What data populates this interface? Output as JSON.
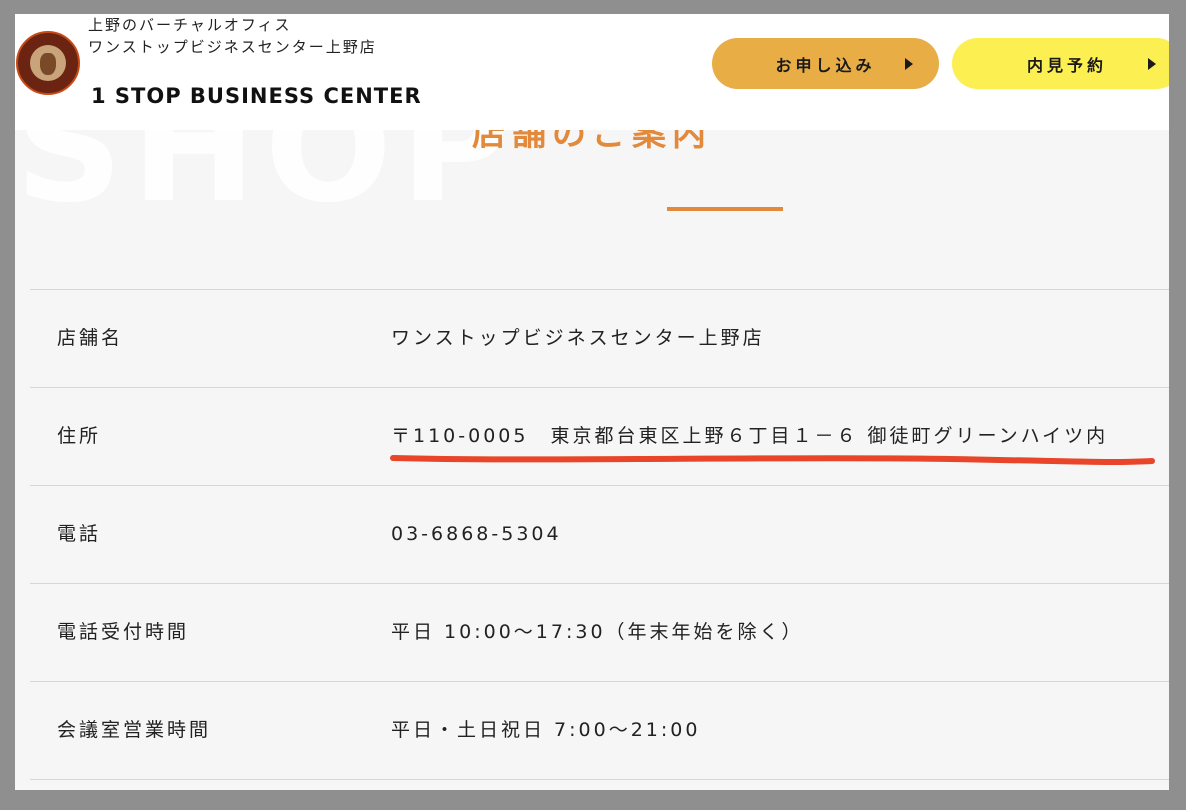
{
  "section": {
    "bg_word": "SHOP",
    "title": "店舗のご案内"
  },
  "header": {
    "tagline_line1": "上野のバーチャルオフィス",
    "tagline_line2": "ワンストップビジネスセンター上野店",
    "brand": "1 STOP BUSINESS CENTER",
    "logo_icon": "business-center-mascot-logo",
    "apply_label": "お申し込み",
    "visit_label": "内見予約"
  },
  "info_table": {
    "rows": [
      {
        "label": "店舗名",
        "value": "ワンストップビジネスセンター上野店"
      },
      {
        "label": "住所",
        "value": "〒110-0005　東京都台東区上野６丁目１－６ 御徒町グリーンハイツ内"
      },
      {
        "label": "電話",
        "value": "03-6868-5304"
      },
      {
        "label": "電話受付時間",
        "value": "平日 10:00〜17:30（年末年始を除く）"
      },
      {
        "label": "会議室営業時間",
        "value": "平日・土日祝日 7:00〜21:00"
      }
    ]
  },
  "colors": {
    "accent_orange": "#e3893b",
    "apply_button": "#e8ad45",
    "visit_button": "#fcef52",
    "annotation_red": "#e8452a"
  }
}
